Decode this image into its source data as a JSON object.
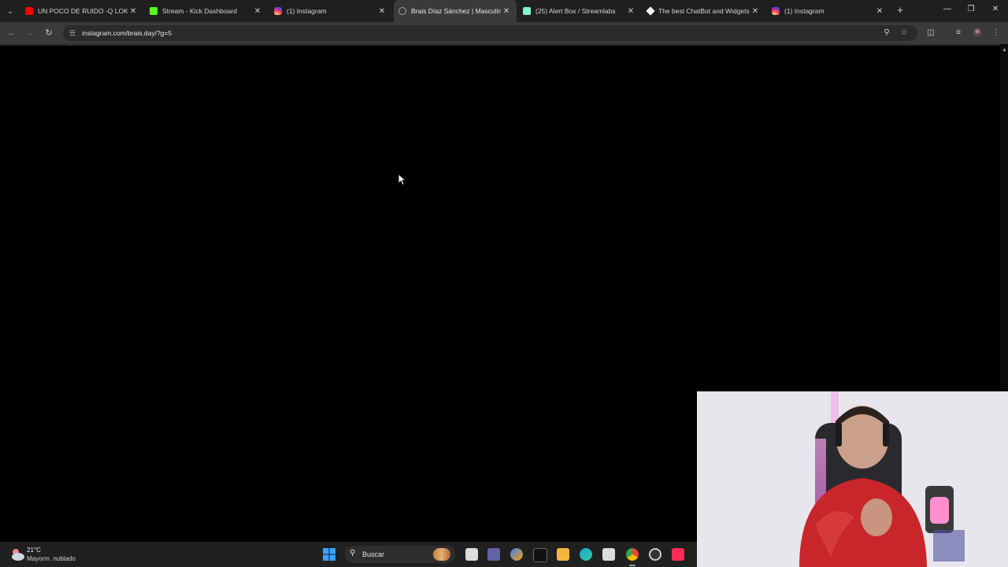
{
  "browser": {
    "tabs": [
      {
        "title": "UN POCO DE RUIDO -Q LOKUR",
        "favicon": "youtube-icon",
        "color": "#ff0000",
        "active": false
      },
      {
        "title": "Stream - Kick Dashboard",
        "favicon": "kick-icon",
        "color": "#53fc18",
        "active": false
      },
      {
        "title": "(1) Instagram",
        "favicon": "instagram-icon",
        "color": "#e1306c",
        "active": false
      },
      {
        "title": "Brais Díaz Sánchez | Masculinid",
        "favicon": "globe-icon",
        "color": "#9aa0a6",
        "active": true
      },
      {
        "title": "(25) Alert Box / Streamlabs",
        "favicon": "streamlabs-icon",
        "color": "#80f5d2",
        "active": false
      },
      {
        "title": "The best ChatBot and Widgets",
        "favicon": "streamelements-icon",
        "color": "#f2f2f2",
        "active": false
      },
      {
        "title": "(1) Instagram",
        "favicon": "instagram-icon",
        "color": "#e1306c",
        "active": false
      }
    ],
    "new_tab_symbol": "+",
    "address": {
      "url": "instagram.com/brais.day/?g=5"
    }
  },
  "taskbar": {
    "weather": {
      "temperature": "21°C",
      "condition": "Mayorm. nublado"
    },
    "search_label": "Buscar",
    "apps": [
      {
        "name": "file-explorer-icon",
        "color": "#f4c430"
      },
      {
        "name": "teams-icon",
        "color": "#6264a7"
      },
      {
        "name": "copilot-icon",
        "color": "#3b82f6"
      },
      {
        "name": "tiktok-icon",
        "color": "#ffffff"
      },
      {
        "name": "folder-icon",
        "color": "#f3b73b"
      },
      {
        "name": "edge-icon",
        "color": "#1fa0d8"
      },
      {
        "name": "store-icon",
        "color": "#dddddd"
      },
      {
        "name": "chrome-icon",
        "color": "#4285f4"
      },
      {
        "name": "obs-icon",
        "color": "#cccccc"
      },
      {
        "name": "tiktok-studio-icon",
        "color": "#fe2c55"
      }
    ]
  }
}
